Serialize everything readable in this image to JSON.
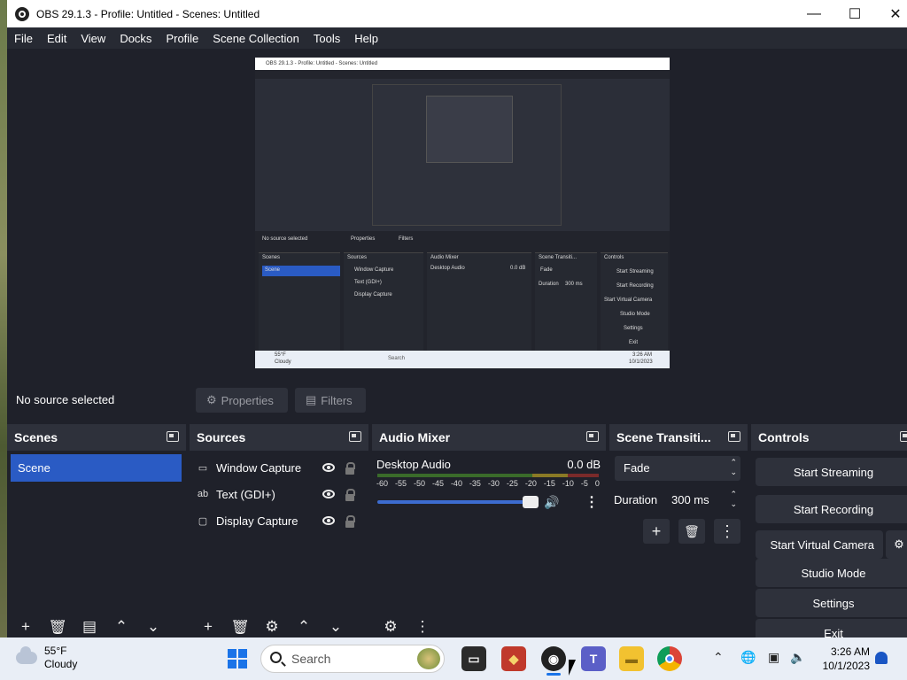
{
  "window": {
    "title": "OBS 29.1.3 - Profile: Untitled - Scenes: Untitled",
    "controls": {
      "minimize": "—",
      "maximize": "☐",
      "close": "✕"
    }
  },
  "menu": [
    "File",
    "Edit",
    "View",
    "Docks",
    "Profile",
    "Scene Collection",
    "Tools",
    "Help"
  ],
  "preview": {
    "title": "OBS 29.1.3 - Profile: Untitled - Scenes: Untitled",
    "no_source": "No source selected",
    "properties": "Properties",
    "filters": "Filters",
    "panels": [
      "Scenes",
      "Sources",
      "Audio Mixer",
      "Scene Transiti...",
      "Controls"
    ],
    "scene": "Scene",
    "sources": [
      "Window Capture",
      "Text (GDI+)",
      "Display Capture"
    ],
    "mixer_name": "Desktop Audio",
    "mixer_db": "0.0 dB",
    "fade": "Fade",
    "duration_label": "Duration",
    "duration": "300 ms",
    "controls": [
      "Start Streaming",
      "Start Recording",
      "Start Virtual Camera",
      "Studio Mode",
      "Settings",
      "Exit"
    ],
    "weather_temp": "55°F",
    "weather_desc": "Cloudy",
    "search": "Search",
    "time": "3:26 AM",
    "date": "10/1/2023"
  },
  "context_bar": {
    "status": "No source selected",
    "properties": "Properties",
    "filters": "Filters"
  },
  "scenes": {
    "title": "Scenes",
    "items": [
      "Scene"
    ]
  },
  "sources": {
    "title": "Sources",
    "items": [
      {
        "label": "Window Capture",
        "icon": "window-icon"
      },
      {
        "label": "Text (GDI+)",
        "icon": "text-icon"
      },
      {
        "label": "Display Capture",
        "icon": "display-icon"
      }
    ]
  },
  "mixer": {
    "title": "Audio Mixer",
    "channel": "Desktop Audio",
    "level": "0.0 dB",
    "scale": [
      "-60",
      "-55",
      "-50",
      "-45",
      "-40",
      "-35",
      "-30",
      "-25",
      "-20",
      "-15",
      "-10",
      "-5",
      "0"
    ],
    "volume_fraction": 1.0
  },
  "transitions": {
    "title": "Scene Transiti...",
    "selected": "Fade",
    "duration_label": "Duration",
    "duration": "300 ms"
  },
  "controls": {
    "title": "Controls",
    "start_streaming": "Start Streaming",
    "start_recording": "Start Recording",
    "start_virtual_camera": "Start Virtual Camera",
    "studio_mode": "Studio Mode",
    "settings": "Settings",
    "exit": "Exit"
  },
  "taskbar": {
    "weather_temp": "55°F",
    "weather_desc": "Cloudy",
    "search_placeholder": "Search",
    "time": "3:26 AM",
    "date": "10/1/2023"
  },
  "colors": {
    "accent": "#2a5bc4",
    "panel_bg": "#262932",
    "window_bg": "#1f212a",
    "taskbar_bg": "#e9eef6"
  }
}
